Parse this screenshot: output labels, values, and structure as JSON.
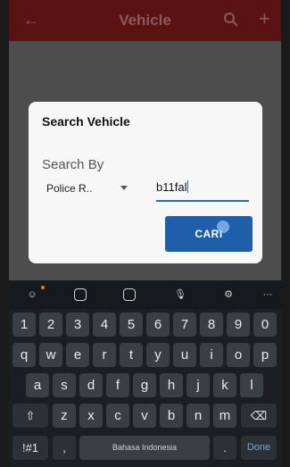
{
  "appbar": {
    "title": "Vehicle",
    "back_icon": "arrow-left-icon",
    "search_icon": "search-icon",
    "add_icon": "plus-icon"
  },
  "dialog": {
    "title": "Search Vehicle",
    "search_by_label": "Search By",
    "select_value": "Police R..",
    "input_value": "b11fal",
    "button_label": "CARI"
  },
  "keyboard": {
    "toolbar": [
      "emoji-icon",
      "clipboard-icon",
      "sticker-icon",
      "mic-icon",
      "settings-icon",
      "more-icon"
    ],
    "row1": [
      "1",
      "2",
      "3",
      "4",
      "5",
      "6",
      "7",
      "8",
      "9",
      "0"
    ],
    "row2": [
      "q",
      "w",
      "e",
      "r",
      "t",
      "y",
      "u",
      "i",
      "o",
      "p"
    ],
    "row3": [
      "a",
      "s",
      "d",
      "f",
      "g",
      "h",
      "j",
      "k",
      "l"
    ],
    "row4": [
      "z",
      "x",
      "c",
      "v",
      "b",
      "n",
      "m"
    ],
    "symbols": "!#1",
    "comma": ",",
    "space": "Bahasa Indonesia",
    "period": ".",
    "done": "Done"
  },
  "colors": {
    "appbar": "#5a1212",
    "button": "#1f5ea8",
    "underline": "#2b6bb5"
  }
}
